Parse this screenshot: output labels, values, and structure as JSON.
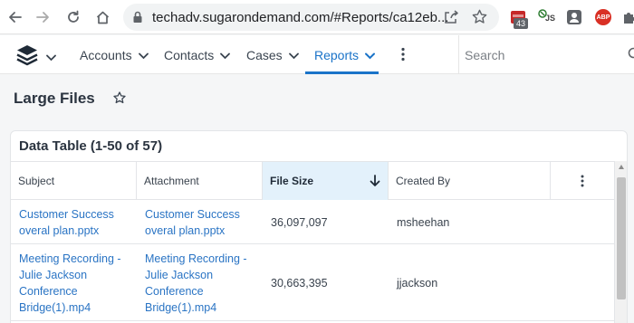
{
  "browser": {
    "url": "techadv.sugarondemand.com/#Reports/ca12eb...",
    "extension_badge": "43",
    "extension_js_label": "JS",
    "adblock_label": "ABP"
  },
  "app_nav": {
    "items": [
      {
        "label": "Accounts"
      },
      {
        "label": "Contacts"
      },
      {
        "label": "Cases"
      },
      {
        "label": "Reports"
      }
    ],
    "active": "Reports",
    "search_placeholder": "Search"
  },
  "page": {
    "title": "Large Files"
  },
  "table": {
    "title": "Data Table (1-50 of 57)",
    "columns": [
      "Subject",
      "Attachment",
      "File Size",
      "Created By"
    ],
    "sorted_column": "File Size",
    "sort_direction": "descending",
    "rows": [
      {
        "subject": "Customer Success overal plan.pptx",
        "attachment": "Customer Success overal plan.pptx",
        "file_size": "36,097,097",
        "created_by": "msheehan"
      },
      {
        "subject": "Meeting Recording - Julie Jackson Conference Bridge(1).mp4",
        "attachment": "Meeting Recording - Julie Jackson Conference Bridge(1).mp4",
        "file_size": "30,663,395",
        "created_by": "jjackson"
      }
    ]
  },
  "colors": {
    "accent": "#1a73c8",
    "link": "#2a74c4",
    "sorted_header_bg": "#e3f1fb"
  }
}
